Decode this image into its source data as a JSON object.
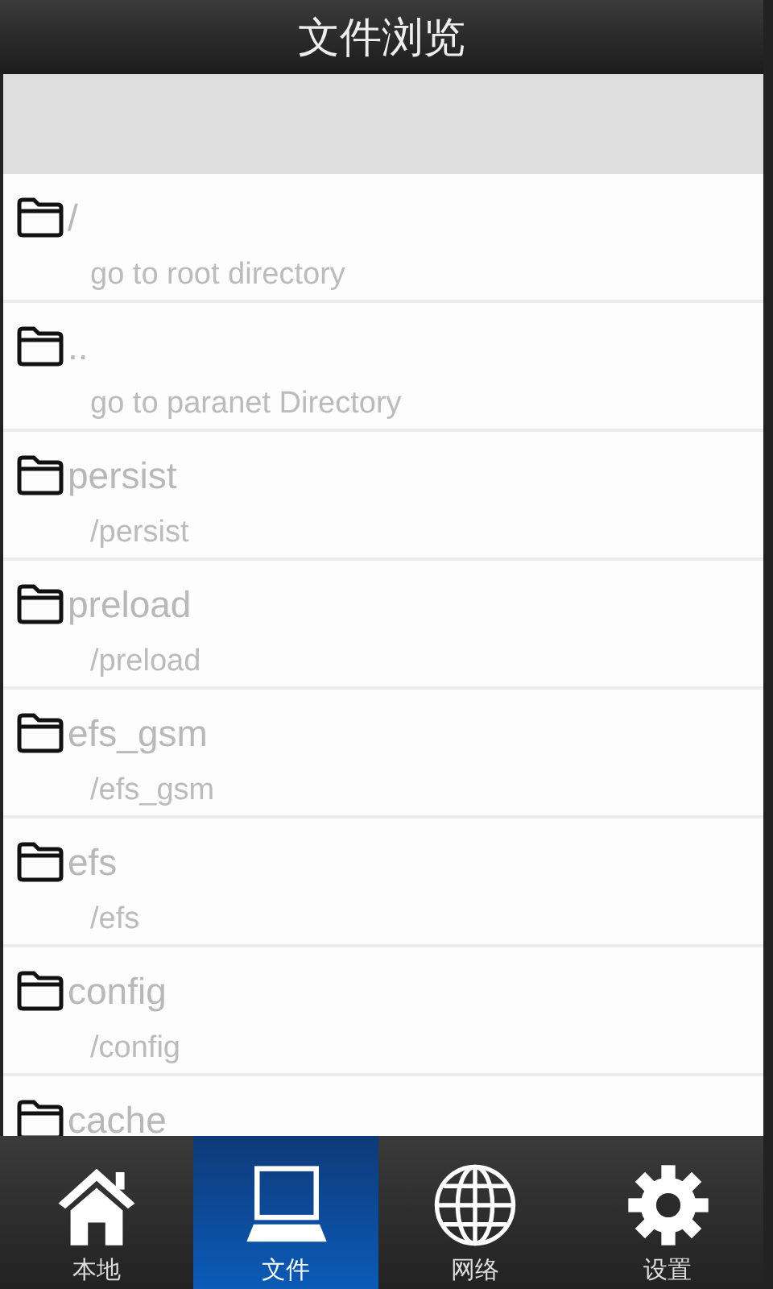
{
  "window": {
    "title": "文件浏览"
  },
  "entries": [
    {
      "name": "/",
      "path": "go to root directory"
    },
    {
      "name": "..",
      "path": "go to paranet Directory"
    },
    {
      "name": "persist",
      "path": "/persist"
    },
    {
      "name": "preload",
      "path": "/preload"
    },
    {
      "name": "efs_gsm",
      "path": "/efs_gsm"
    },
    {
      "name": "efs",
      "path": "/efs"
    },
    {
      "name": "config",
      "path": "/config"
    },
    {
      "name": "cache"
    }
  ],
  "tabs": [
    {
      "label": "本地",
      "selected": false
    },
    {
      "label": "文件",
      "selected": true
    },
    {
      "label": "网络",
      "selected": false
    },
    {
      "label": "设置",
      "selected": false
    }
  ]
}
